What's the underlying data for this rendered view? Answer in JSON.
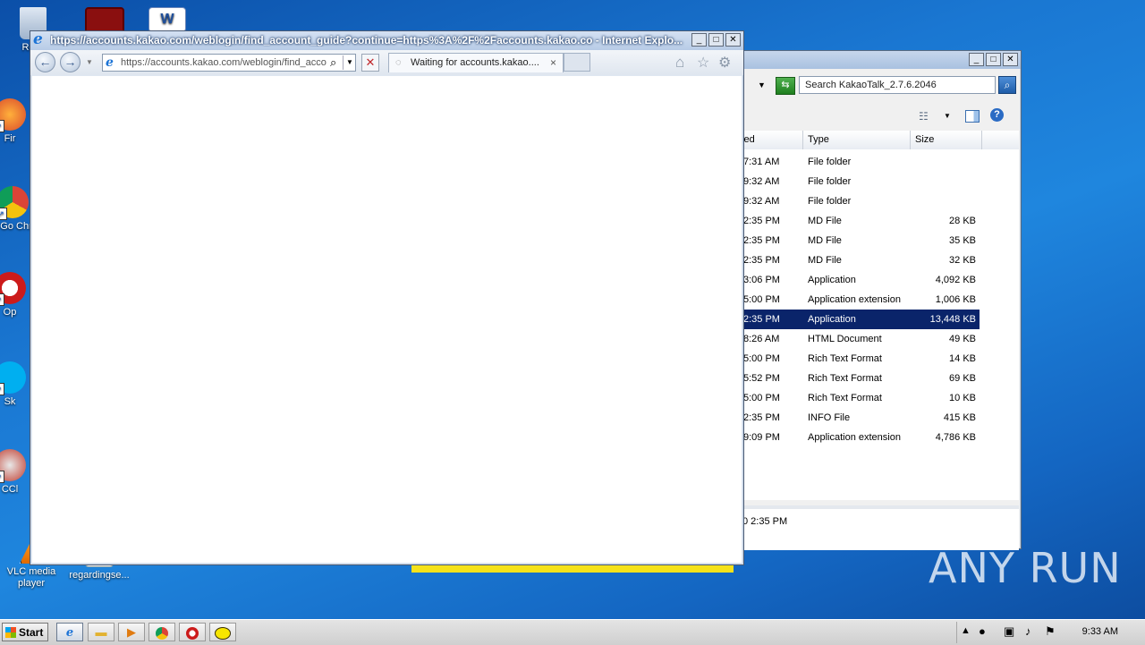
{
  "desktop": {
    "icons": [
      {
        "label": "Recy"
      },
      {
        "label": "Fir"
      },
      {
        "label": "Go Chr"
      },
      {
        "label": "Op"
      },
      {
        "label": "Sk"
      },
      {
        "label": "CCl"
      },
      {
        "label": "VLC media player"
      },
      {
        "label": "regardingse..."
      }
    ]
  },
  "ie": {
    "title": "https://accounts.kakao.com/weblogin/find_account_guide?continue=https%3A%2F%2Faccounts.kakao.co - Internet Explo...",
    "address": "https://accounts.kakao.com/weblogin/find_acco",
    "tab_label": "Waiting for accounts.kakao....",
    "tab_close": "×"
  },
  "explorer": {
    "search_placeholder": "Search KakaoTalk_2.7.6.2046",
    "columns": {
      "modified": "fied",
      "type": "Type",
      "size": "Size"
    },
    "rows": [
      {
        "modified": "7:31 AM",
        "type": "File folder",
        "size": ""
      },
      {
        "modified": "9:32 AM",
        "type": "File folder",
        "size": ""
      },
      {
        "modified": "9:32 AM",
        "type": "File folder",
        "size": ""
      },
      {
        "modified": "2:35 PM",
        "type": "MD File",
        "size": "28 KB"
      },
      {
        "modified": "2:35 PM",
        "type": "MD File",
        "size": "35 KB"
      },
      {
        "modified": "2:35 PM",
        "type": "MD File",
        "size": "32 KB"
      },
      {
        "modified": "3:06 PM",
        "type": "Application",
        "size": "4,092 KB"
      },
      {
        "modified": "5:00 PM",
        "type": "Application extension",
        "size": "1,006 KB"
      },
      {
        "modified": "2:35 PM",
        "type": "Application",
        "size": "13,448 KB",
        "selected": true
      },
      {
        "modified": "8:26 AM",
        "type": "HTML Document",
        "size": "49 KB"
      },
      {
        "modified": "5:00 PM",
        "type": "Rich Text Format",
        "size": "14 KB"
      },
      {
        "modified": "5:52 PM",
        "type": "Rich Text Format",
        "size": "69 KB"
      },
      {
        "modified": "5:00 PM",
        "type": "Rich Text Format",
        "size": "10 KB"
      },
      {
        "modified": "2:35 PM",
        "type": "INFO File",
        "size": "415 KB"
      },
      {
        "modified": "9:09 PM",
        "type": "Application extension",
        "size": "4,786 KB"
      }
    ],
    "details_date": "0 2:35 PM"
  },
  "taskbar": {
    "start_label": "Start",
    "clock": "9:33 AM"
  },
  "watermark": "ANY RUN",
  "colors": {
    "selection": "#0a246a",
    "desktop": "#1a77d2",
    "yellow_bar": "#f5e21a"
  }
}
